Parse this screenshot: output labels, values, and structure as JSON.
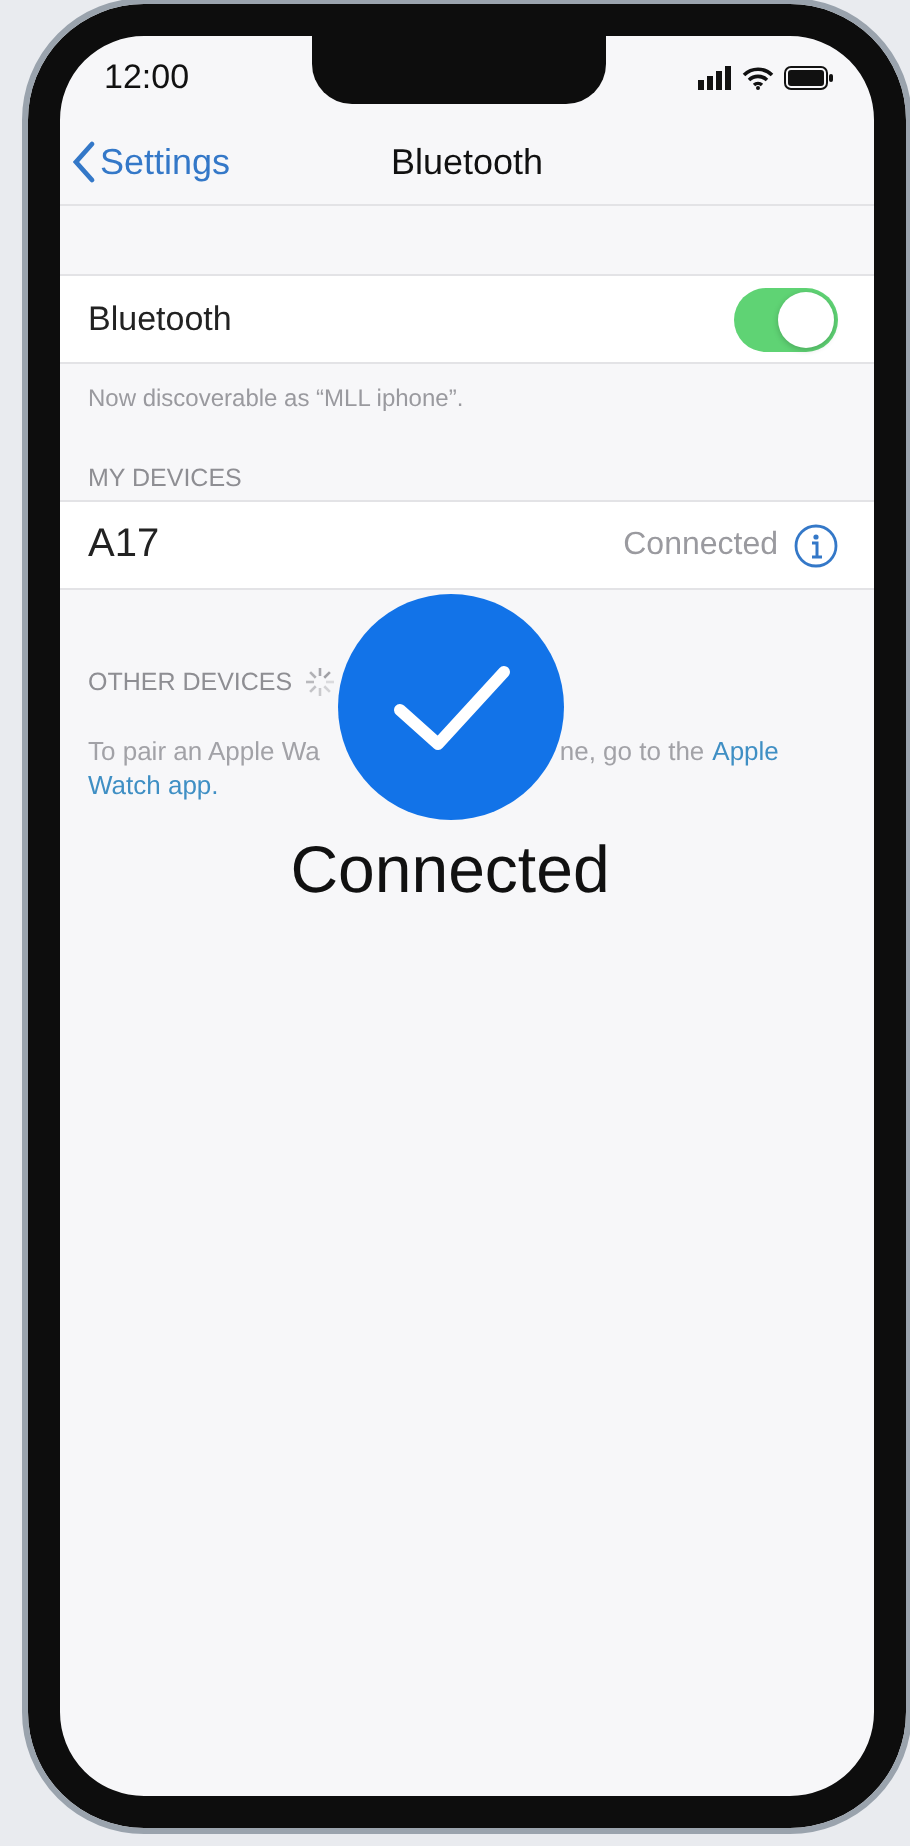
{
  "status_bar": {
    "time": "12:00"
  },
  "nav": {
    "back": "Settings",
    "title": "Bluetooth"
  },
  "bluetooth": {
    "label": "Bluetooth",
    "on": true,
    "footer": "Now discoverable as “MLL iphone”."
  },
  "my_devices": {
    "header": "MY DEVICES",
    "devices": [
      {
        "name": "A17",
        "status": "Connected"
      }
    ]
  },
  "other_devices": {
    "header": "OTHER DEVICES",
    "searching": true,
    "hint_before": "To pair an Apple Wa",
    "hint_after": "ne, go to the",
    "link_lines": [
      "Apple",
      "Watch app."
    ]
  },
  "overlay": {
    "label": "Connected"
  }
}
